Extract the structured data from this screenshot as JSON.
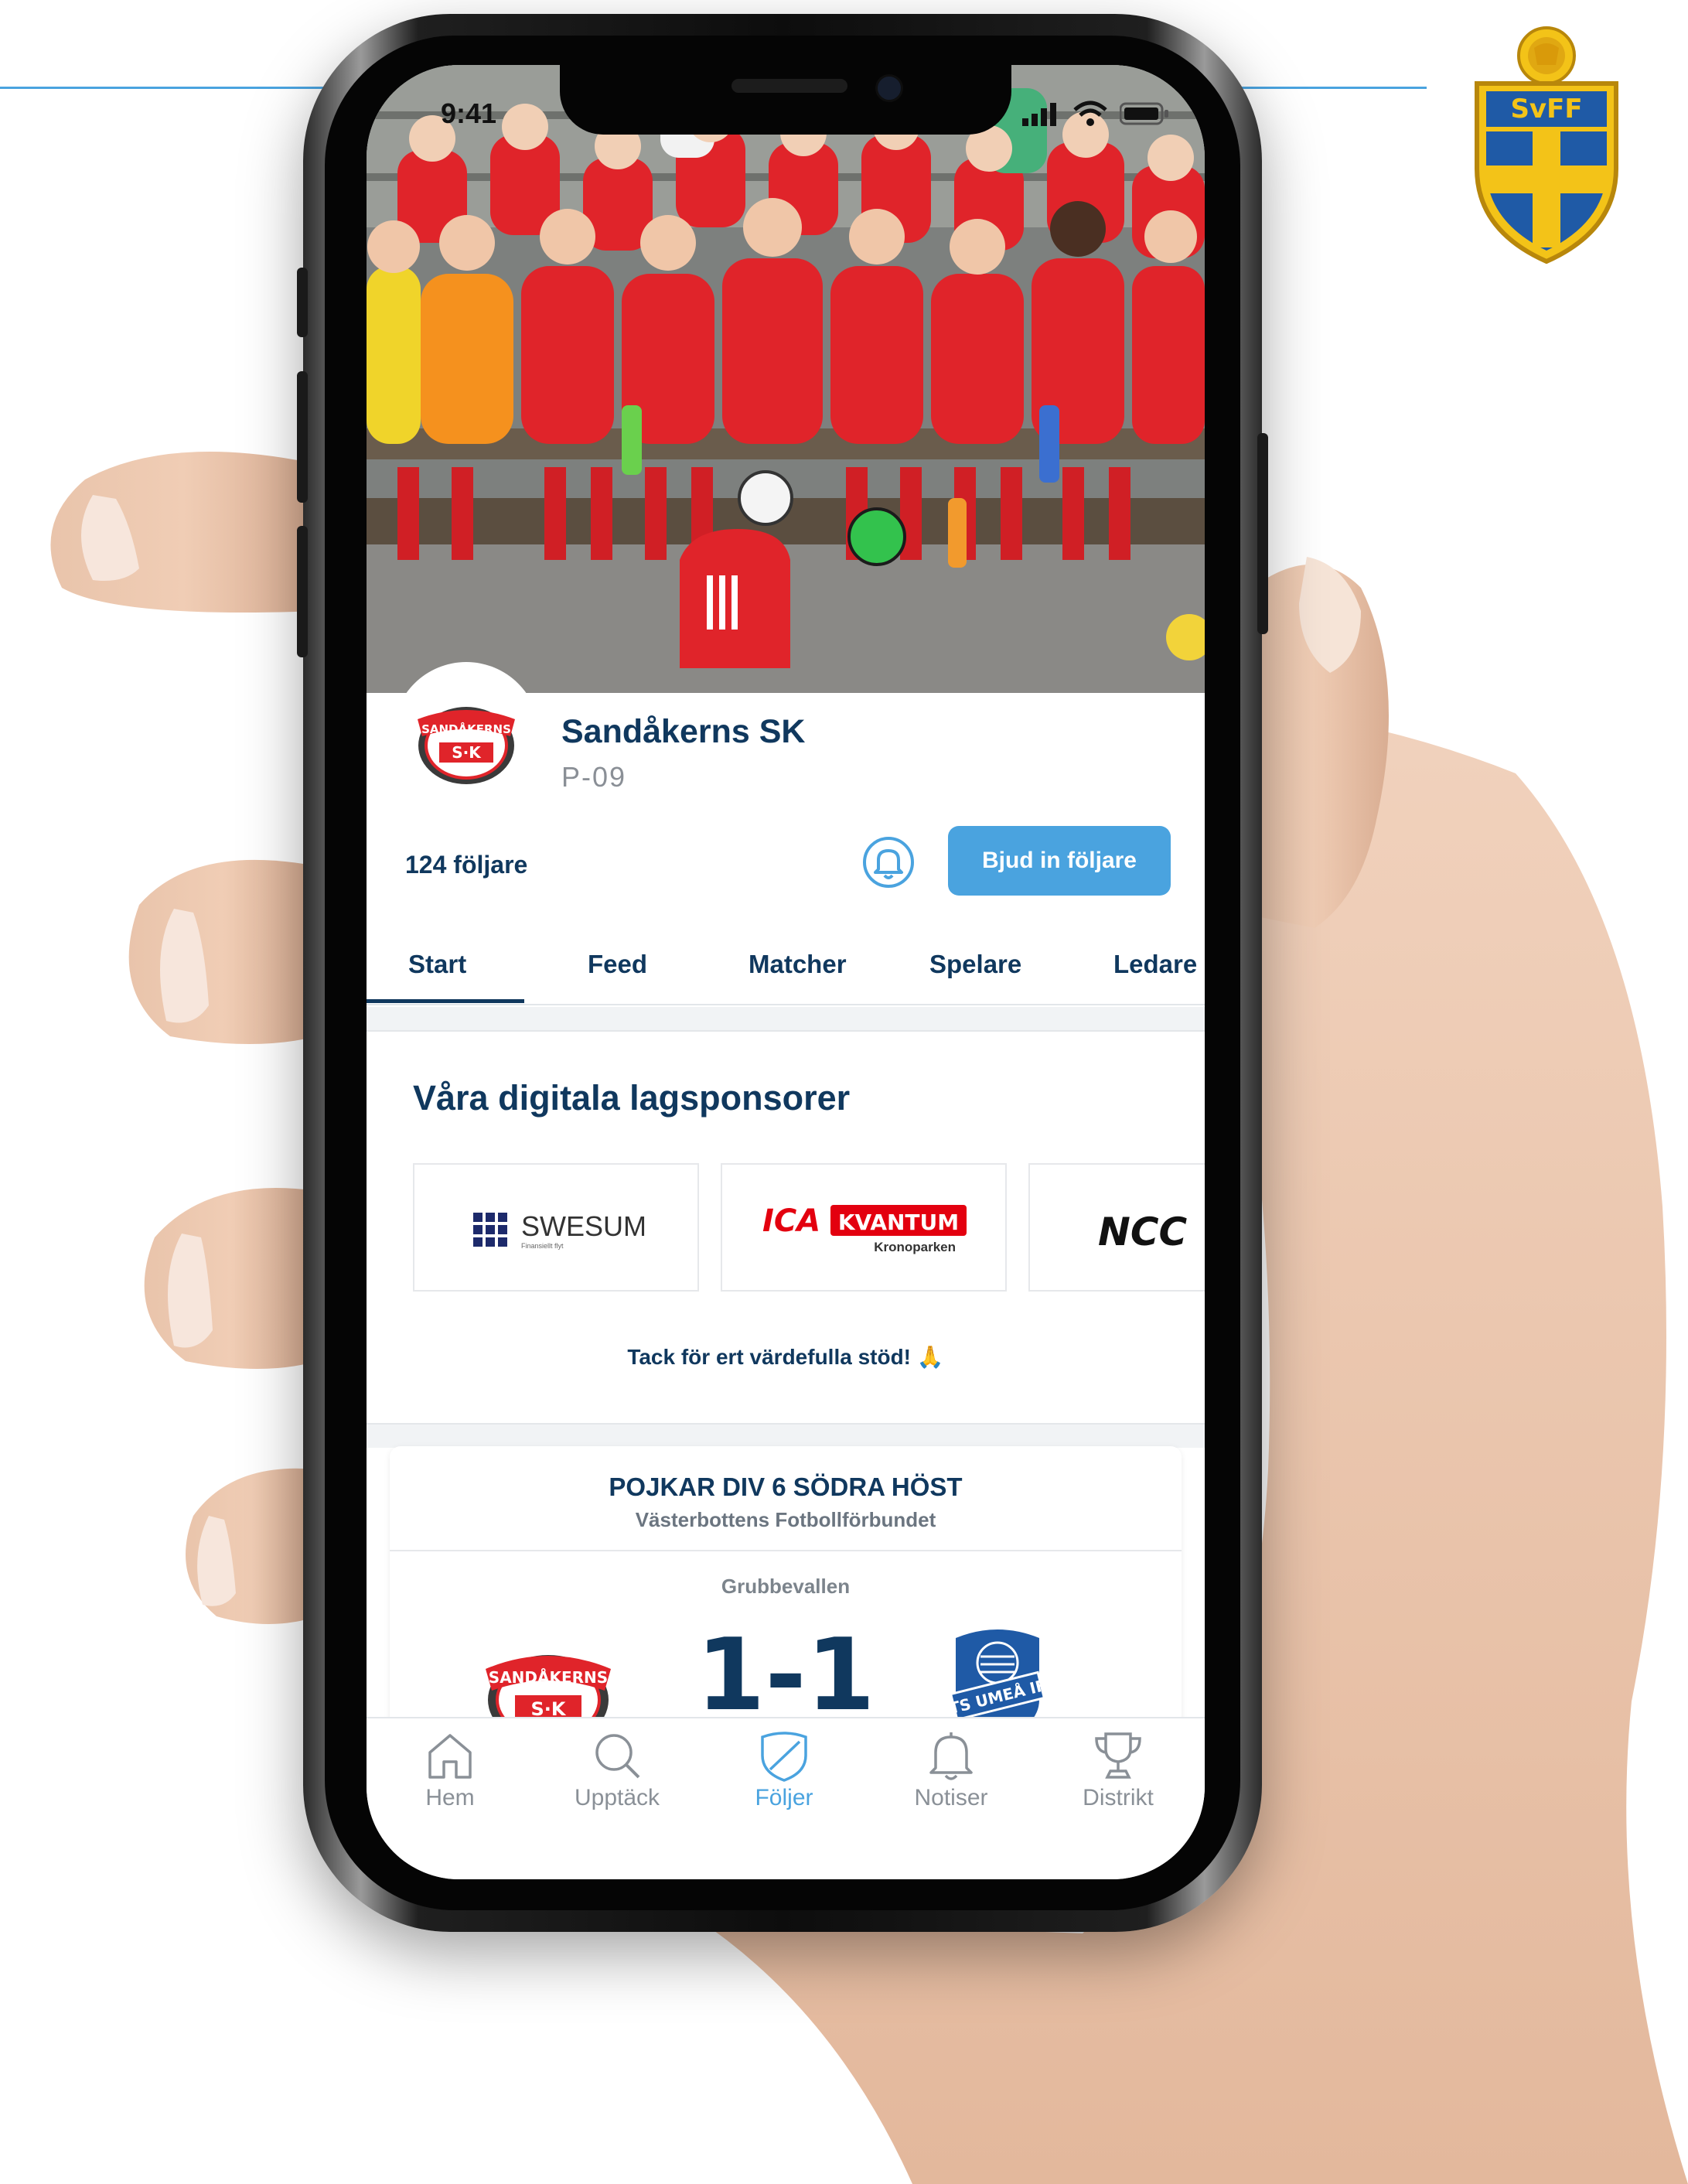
{
  "status_bar": {
    "time": "9:41"
  },
  "team": {
    "name": "Sandåkerns SK",
    "subtitle": "P-09",
    "followers": "124 följare",
    "invite_label": "Bjud in följare",
    "crest_text_top": "SANDÅKERNS",
    "crest_text_bottom": "S·K"
  },
  "tabs": [
    {
      "label": "Start",
      "active": true
    },
    {
      "label": "Feed"
    },
    {
      "label": "Matcher"
    },
    {
      "label": "Spelare"
    },
    {
      "label": "Ledare"
    }
  ],
  "sponsors": {
    "title": "Våra digitala lagsponsorer",
    "items": [
      {
        "name": "SWESUM",
        "tagline": "Finansiellt flyt"
      },
      {
        "name_left": "ICA",
        "name_right": "KVANTUM",
        "tagline": "Kronoparken"
      },
      {
        "name": "NCC"
      }
    ],
    "thanks": "Tack för ert värdefulla stöd! 🙏"
  },
  "match": {
    "league": "POJKAR DIV 6 SÖDRA HÖST",
    "federation": "Västerbottens Fotbollförbundet",
    "venue": "Grubbevallen",
    "score": "1-1",
    "away_badge_text": "TS UMEÅ IF"
  },
  "bottom_nav": [
    {
      "label": "Hem",
      "icon": "home-icon"
    },
    {
      "label": "Upptäck",
      "icon": "search-icon"
    },
    {
      "label": "Följer",
      "icon": "shield-icon",
      "active": true
    },
    {
      "label": "Notiser",
      "icon": "bell-icon"
    },
    {
      "label": "Distrikt",
      "icon": "trophy-icon"
    }
  ],
  "emblem": {
    "text": "SvFF"
  },
  "colors": {
    "brand_navy": "#10385e",
    "accent_blue": "#4aa3df",
    "ica_red": "#e3000f",
    "kit_red": "#e0242a",
    "svff_blue": "#1f5aa6",
    "svff_yellow": "#f3c318"
  }
}
